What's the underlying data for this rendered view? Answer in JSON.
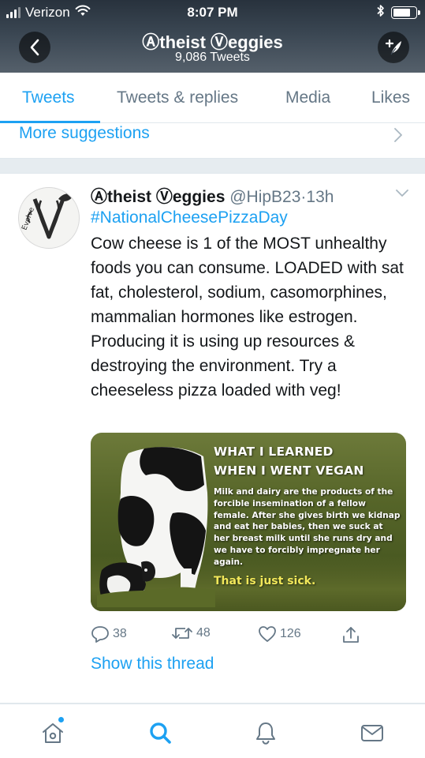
{
  "status_bar": {
    "carrier": "Verizon",
    "time": "8:07 PM"
  },
  "header": {
    "profile_name": "Ⓐtheist Ⓥeggies",
    "tweet_count": "9,086 Tweets",
    "back_icon": "chevron-left-icon",
    "compose_icon": "compose-tweet-icon"
  },
  "tabs": [
    {
      "label": "Tweets",
      "active": true
    },
    {
      "label": "Tweets & replies",
      "active": false
    },
    {
      "label": "Media",
      "active": false
    },
    {
      "label": "Likes",
      "active": false
    }
  ],
  "suggestions": {
    "label": "More suggestions"
  },
  "tweet": {
    "name": "Ⓐtheist Ⓥeggies",
    "handle": "@HipB23",
    "dot": "·",
    "time": "13h",
    "hashtag": "#NationalCheesePizzaDay",
    "text": "Cow cheese is 1 of the MOST unhealthy foods you can consume. LOADED with sat fat, cholesterol, sodium, casomorphines, mammalian hormones like estrogen. Producing it is using up resources & destroying the environment. Try a cheeseless pizza loaded with veg!",
    "avatar_text": "Evolve",
    "media": {
      "heading_1": "WHAT I LEARNED",
      "heading_2": "WHEN I WENT VEGAN",
      "body": "Milk and dairy are the products of the forcible insemination of a fellow female. After she gives birth we kidnap and eat her babies, then we suck at her breast milk until she runs dry and we have to forcibly impregnate her again.",
      "footer": "That is just sick."
    },
    "actions": {
      "replies": "38",
      "retweets": "48",
      "likes": "126"
    },
    "show_thread": "Show this thread"
  },
  "bottom_nav": [
    {
      "name": "home",
      "icon": "home-icon",
      "has_notification_dot": true
    },
    {
      "name": "search",
      "icon": "search-icon",
      "active": true
    },
    {
      "name": "notifications",
      "icon": "bell-icon"
    },
    {
      "name": "messages",
      "icon": "mail-icon"
    }
  ],
  "colors": {
    "accent": "#1da1f2",
    "secondary_text": "#657786",
    "divider": "#e1e8ed",
    "separator_bg": "#e6ecf0",
    "media_highlight": "#f2e85a"
  }
}
